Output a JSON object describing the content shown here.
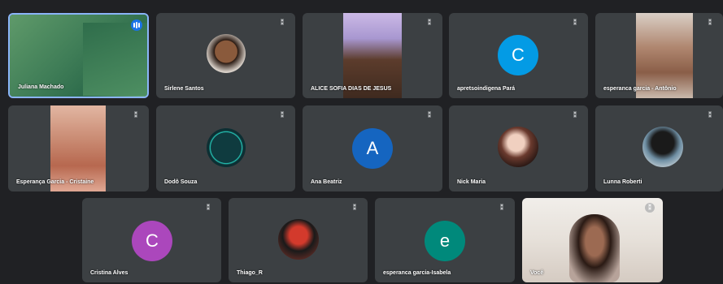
{
  "participants": [
    {
      "name": "Juliana Machado",
      "tile": "video"
    },
    {
      "name": "Sirlene Santos",
      "tile": "avatar"
    },
    {
      "name": "ALICE SOFIA DIAS DE JESUS",
      "tile": "video"
    },
    {
      "name": "apretsoindigena Pará",
      "tile": "letter",
      "letter": "C",
      "color": "#039be5"
    },
    {
      "name": "esperanca garcia - Antônio",
      "tile": "video"
    },
    {
      "name": "Esperança Garcia - Cristaine",
      "tile": "video"
    },
    {
      "name": "Dodô Souza",
      "tile": "avatar"
    },
    {
      "name": "Ana Beatriz",
      "tile": "letter",
      "letter": "A",
      "color": "#1565c0"
    },
    {
      "name": "Nick Maria",
      "tile": "avatar"
    },
    {
      "name": "Lunna Roberti",
      "tile": "avatar"
    },
    {
      "name": "Cristina Alves",
      "tile": "letter",
      "letter": "C",
      "color": "#ab47bc"
    },
    {
      "name": "Thiago_R",
      "tile": "avatar"
    },
    {
      "name": "esperanca garcia-Isabela",
      "tile": "letter",
      "letter": "e",
      "color": "#00897b"
    },
    {
      "name": "Você",
      "tile": "video"
    }
  ],
  "icons": {
    "mic_off": "mic-off-icon",
    "speaking": "audio-level-icon"
  }
}
